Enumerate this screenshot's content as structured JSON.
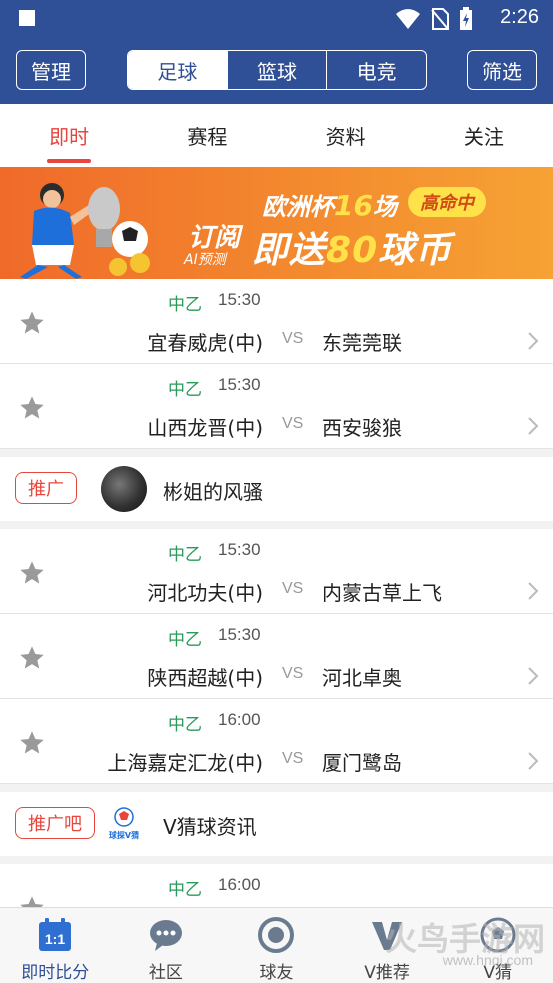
{
  "status_bar": {
    "time": "2:26"
  },
  "header": {
    "manage_label": "管理",
    "filter_label": "筛选",
    "segments": [
      "足球",
      "篮球",
      "电竞"
    ],
    "active_segment": "足球"
  },
  "subtabs": {
    "items": [
      "即时",
      "赛程",
      "资料",
      "关注"
    ],
    "active": "即时"
  },
  "banner": {
    "line1_prefix": "欧洲杯",
    "line1_num": "16",
    "line1_suffix": "场",
    "tag": "高命中",
    "sub1": "订阅",
    "sub2": "AI预测",
    "big_prefix": "即送",
    "big_num": "80",
    "big_suffix": "球币"
  },
  "matches_1": [
    {
      "league": "中乙",
      "time": "15:30",
      "home": "宜春威虎(中)",
      "vs": "VS",
      "away": "东莞莞联"
    },
    {
      "league": "中乙",
      "time": "15:30",
      "home": "山西龙晋(中)",
      "vs": "VS",
      "away": "西安骏狼"
    }
  ],
  "promo_1": {
    "tag": "推广",
    "name": "彬姐的风骚"
  },
  "matches_2": [
    {
      "league": "中乙",
      "time": "15:30",
      "home": "河北功夫(中)",
      "vs": "VS",
      "away": "内蒙古草上飞"
    },
    {
      "league": "中乙",
      "time": "15:30",
      "home": "陕西超越(中)",
      "vs": "VS",
      "away": "河北卓奥"
    },
    {
      "league": "中乙",
      "time": "16:00",
      "home": "上海嘉定汇龙(中)",
      "vs": "VS",
      "away": "厦门鹭岛"
    }
  ],
  "promo_2": {
    "tag": "推广吧",
    "name": "V猜球资讯",
    "logo_text": "球探V猜"
  },
  "matches_3": [
    {
      "league": "中乙",
      "time": "16:00"
    }
  ],
  "bottom_nav": {
    "items": [
      "即时比分",
      "社区",
      "球友",
      "V推荐",
      "V猜"
    ],
    "active": "即时比分",
    "calendar_icon_text": "1:1"
  },
  "watermark": {
    "main": "火鸟手游网",
    "url": "www.hnqj.com"
  },
  "colors": {
    "primary": "#2f4f97",
    "accent": "#e8453c",
    "league_green": "#2a9a5a"
  }
}
